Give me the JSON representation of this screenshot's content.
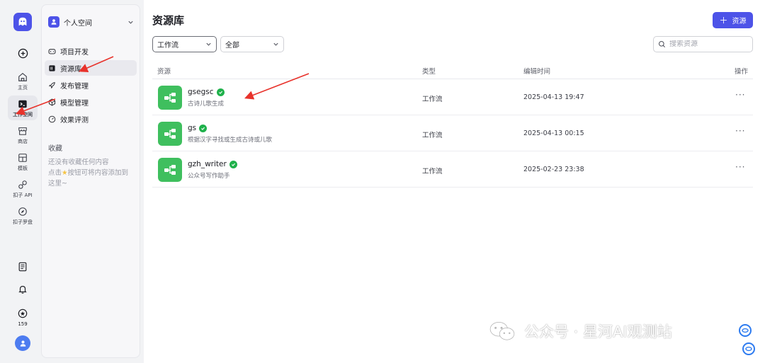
{
  "rail": {
    "items": [
      {
        "label": "主页",
        "icon": "home-icon"
      },
      {
        "label": "工作空间",
        "icon": "terminal-icon"
      },
      {
        "label": "商店",
        "icon": "store-icon"
      },
      {
        "label": "模板",
        "icon": "template-icon"
      },
      {
        "label": "扣子 API",
        "icon": "link-icon"
      },
      {
        "label": "扣子罗盘",
        "icon": "compass-icon"
      }
    ],
    "bottom": {
      "badge_count": "159"
    }
  },
  "panel": {
    "space_name": "个人空间",
    "menu": [
      {
        "label": "项目开发",
        "icon": "gamepad-icon"
      },
      {
        "label": "资源库",
        "icon": "library-icon"
      },
      {
        "label": "发布管理",
        "icon": "rocket-icon"
      },
      {
        "label": "模型管理",
        "icon": "cube-icon"
      },
      {
        "label": "效果评测",
        "icon": "gauge-icon"
      }
    ],
    "favorites_title": "收藏",
    "favorites_empty_line1": "还没有收藏任何内容",
    "favorites_empty_line2": "点击",
    "favorites_empty_line3": "按钮可将内容添加到",
    "favorites_empty_line4": "这里~"
  },
  "main": {
    "title": "资源库",
    "add_button": "资源",
    "filter_type": "工作流",
    "filter_scope": "全部",
    "search_placeholder": "搜索资源",
    "columns": {
      "resource": "资源",
      "type": "类型",
      "edited": "编辑时间",
      "action": "操作"
    },
    "rows": [
      {
        "name": "gsegsc",
        "desc": "古诗儿歌生成",
        "type": "工作流",
        "time": "2025-04-13 19:47",
        "more": "···"
      },
      {
        "name": "gs",
        "desc": "根据汉字寻找或生成古诗或儿歌",
        "type": "工作流",
        "time": "2025-04-13 00:15",
        "more": "···"
      },
      {
        "name": "gzh_writer",
        "desc": "公众号写作助手",
        "type": "工作流",
        "time": "2025-02-23 23:38",
        "more": "···"
      }
    ]
  },
  "watermark": "公众号 · 星河AI观测站",
  "colors": {
    "accent": "#4d53e8",
    "workflow_icon": "#3fbf5e",
    "verified": "#1fb14b",
    "arrow": "#e8322b"
  }
}
